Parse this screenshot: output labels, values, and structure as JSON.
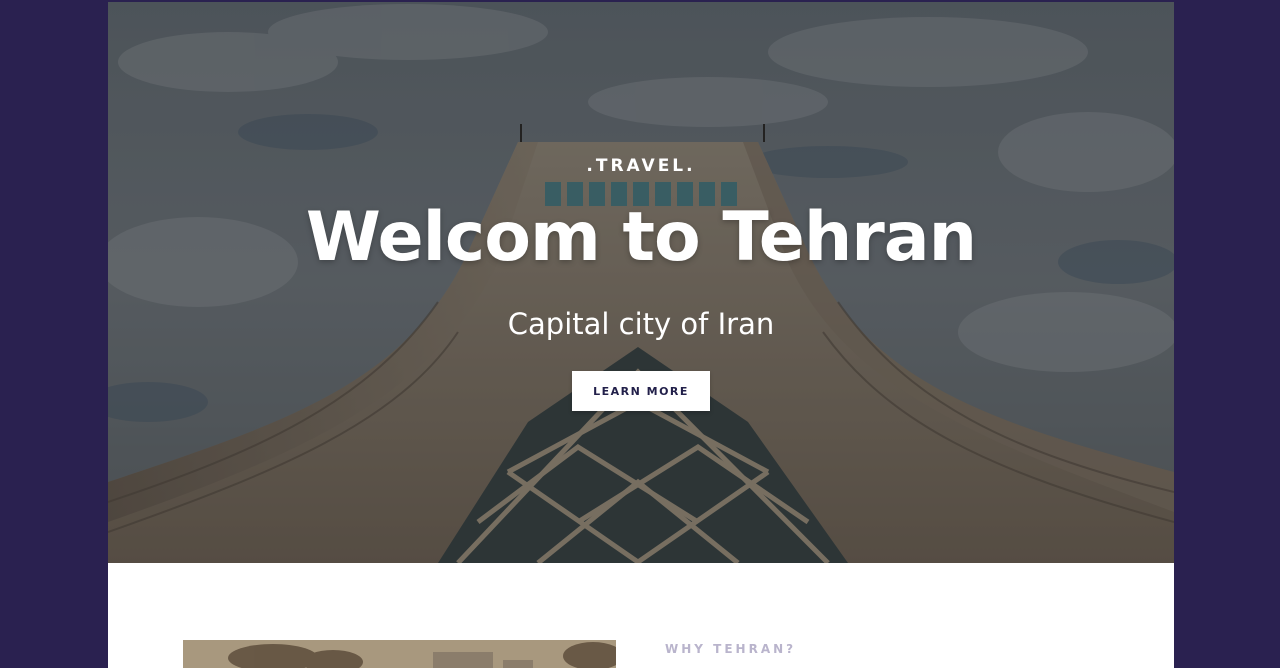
{
  "hero": {
    "eyebrow": ".TRAVEL.",
    "title": "Welcom to Tehran",
    "subtitle": "Capital city of Iran",
    "cta_label": "LEARN MORE",
    "background_icon": "azadi-tower-photo"
  },
  "about": {
    "section_label": "WHY TEHRAN?",
    "image_icon": "tehran-street-photo"
  },
  "colors": {
    "backdrop": "#2a2150",
    "page": "#ffffff",
    "button_text": "#22204a",
    "section_label": "#b9b4cc"
  }
}
